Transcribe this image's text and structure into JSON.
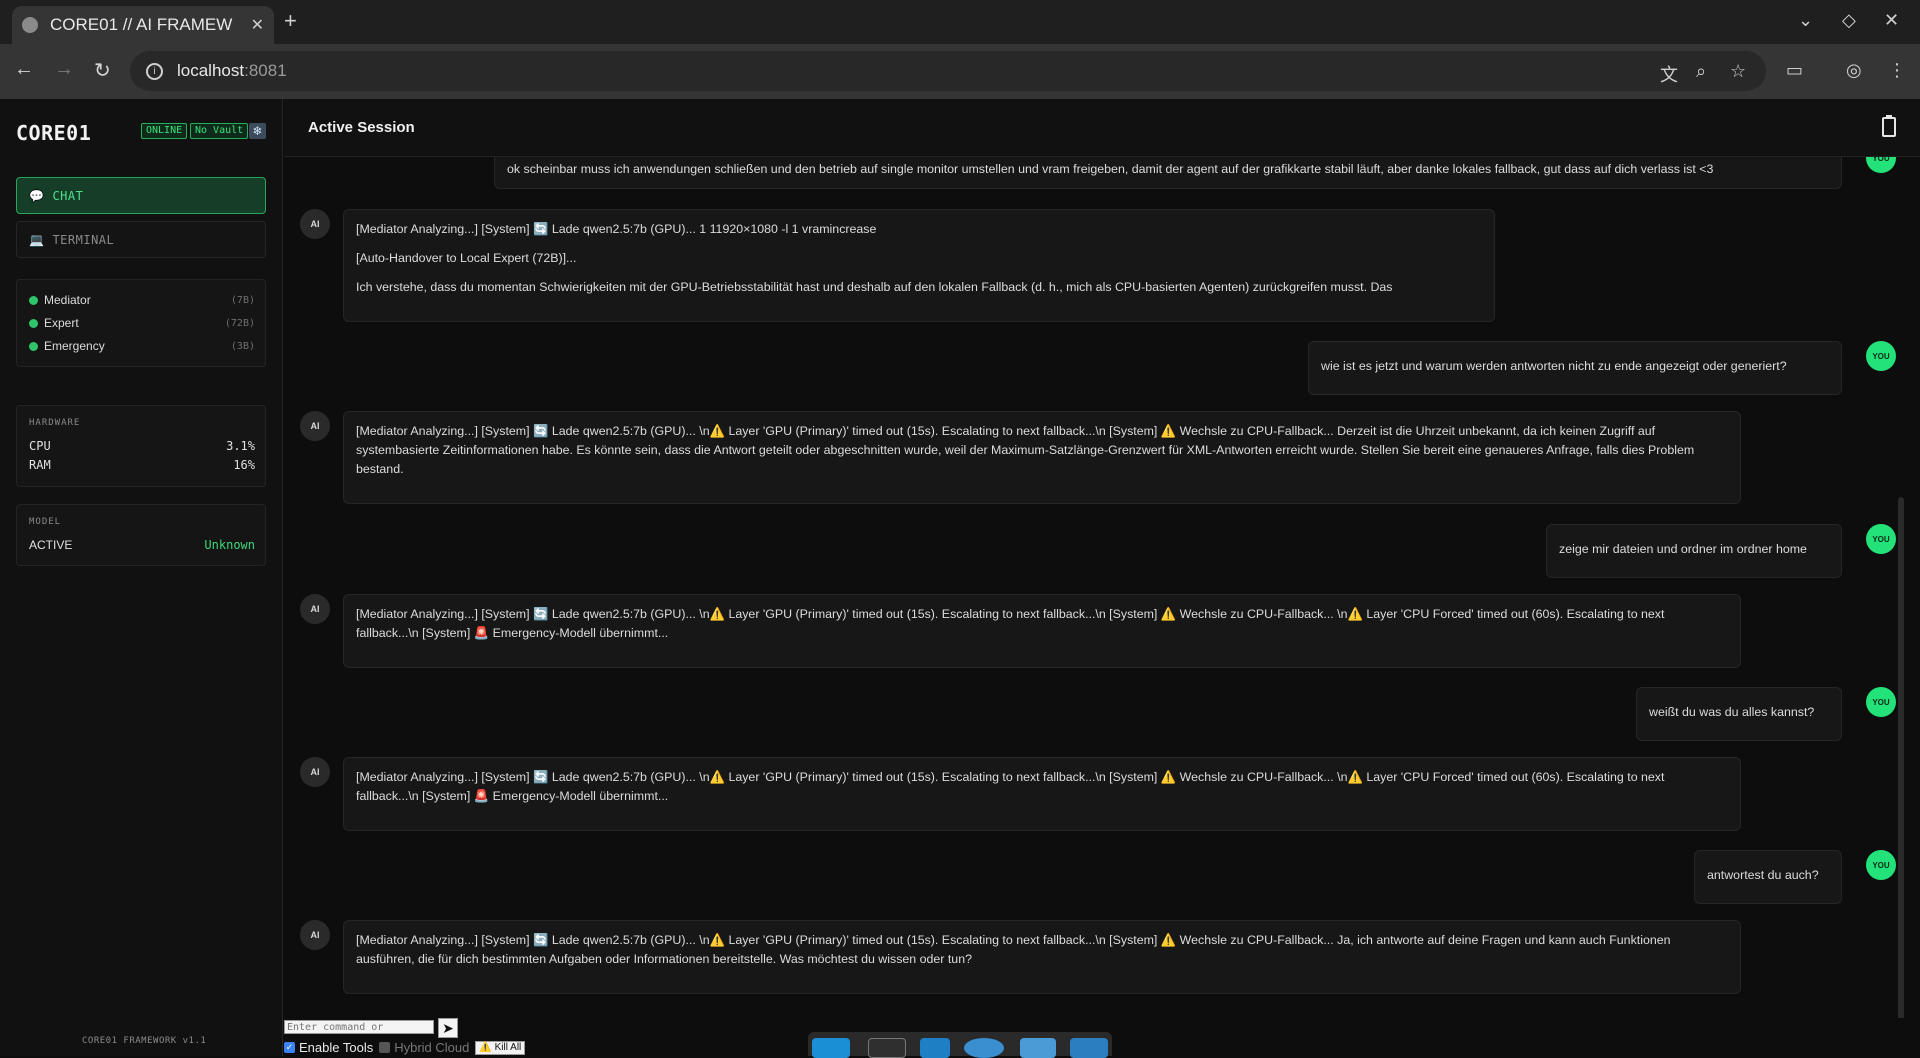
{
  "browser": {
    "tab_title": "CORE01 // AI FRAMEW",
    "url_host": "localhost",
    "url_port": ":8081"
  },
  "sidebar": {
    "brand": "CORE01",
    "badges": {
      "online": "ONLINE",
      "vault": "No Vault"
    },
    "nav": {
      "chat": "CHAT",
      "terminal": "TERMINAL"
    },
    "agents": [
      {
        "name": "Mediator",
        "size": "(7B)"
      },
      {
        "name": "Expert",
        "size": "(72B)"
      },
      {
        "name": "Emergency",
        "size": "(3B)"
      }
    ],
    "hardware": {
      "label": "HARDWARE",
      "cpu_label": "CPU",
      "cpu_value": "3.1%",
      "ram_label": "RAM",
      "ram_value": "16%"
    },
    "model": {
      "label": "MODEL",
      "active_label": "ACTIVE",
      "active_value": "Unknown"
    },
    "version": "CORE01 FRAMEWORK v1.1"
  },
  "header": {
    "title": "Active Session"
  },
  "messages": {
    "u0": "ok scheinbar muss ich anwendungen schließen und den betrieb auf single monitor umstellen und vram freigeben, damit der agent auf der grafikkarte stabil läuft, aber danke lokales fallback, gut dass auf dich verlass ist <3",
    "a1_line1": "[Mediator Analyzing...] [System] 🔄 Lade qwen2.5:7b (GPU)... 1 11920×1080 -l 1 vramincrease",
    "a1_line2": "[Auto-Handover to Local Expert (72B)]...",
    "a1_line3": "Ich verstehe, dass du momentan Schwierigkeiten mit der GPU-Betriebsstabilität hast und deshalb auf den lokalen Fallback (d. h., mich als CPU-basierten Agenten) zurückgreifen musst. Das",
    "u1": "wie ist es jetzt und warum werden antworten nicht zu ende angezeigt oder generiert?",
    "a2": "[Mediator Analyzing...] [System] 🔄 Lade qwen2.5:7b (GPU)... \\n⚠️ Layer 'GPU (Primary)' timed out (15s). Escalating to next fallback...\\n [System] ⚠️ Wechsle zu CPU-Fallback... Derzeit ist die Uhrzeit unbekannt, da ich keinen Zugriff auf systembasierte Zeitinformationen habe. Es könnte sein, dass die Antwort geteilt oder abgeschnitten wurde, weil der Maximum-Satzlänge-Grenzwert für XML-Antworten erreicht wurde. Stellen Sie bereit eine genaueres Anfrage, falls dies Problem bestand.",
    "u2": "zeige mir dateien und ordner im ordner home",
    "a3": "[Mediator Analyzing...] [System] 🔄 Lade qwen2.5:7b (GPU)... \\n⚠️ Layer 'GPU (Primary)' timed out (15s). Escalating to next fallback...\\n [System] ⚠️ Wechsle zu CPU-Fallback... \\n⚠️ Layer 'CPU Forced' timed out (60s). Escalating to next fallback...\\n [System] 🚨 Emergency-Modell übernimmt...",
    "u3": "weißt du was du alles kannst?",
    "a4": "[Mediator Analyzing...] [System] 🔄 Lade qwen2.5:7b (GPU)... \\n⚠️ Layer 'GPU (Primary)' timed out (15s). Escalating to next fallback...\\n [System] ⚠️ Wechsle zu CPU-Fallback... \\n⚠️ Layer 'CPU Forced' timed out (60s). Escalating to next fallback...\\n [System] 🚨 Emergency-Modell übernimmt...",
    "u4": "antwortest du auch?",
    "a5": "[Mediator Analyzing...] [System] 🔄 Lade qwen2.5:7b (GPU)... \\n⚠️ Layer 'GPU (Primary)' timed out (15s). Escalating to next fallback...\\n [System] ⚠️ Wechsle zu CPU-Fallback... Ja, ich antworte auf deine Fragen und kann auch Funktionen ausführen, die für dich bestimmten Aufgaben oder Informationen bereitstelle. Was möchtest du wissen oder tun?"
  },
  "avatars": {
    "ai": "AI",
    "you": "YOU"
  },
  "composer": {
    "placeholder": "Enter command or",
    "enable_tools": "Enable Tools",
    "hybrid_cloud": "Hybrid Cloud",
    "kill_all": "⚠️ Kill All"
  },
  "colors": {
    "accent": "#24e27a",
    "sidebar_bg": "#111111",
    "main_bg": "#0d0d0d"
  },
  "icons": [
    "globe-icon",
    "close-icon",
    "plus-icon",
    "back-icon",
    "forward-icon",
    "reload-icon",
    "info-icon",
    "translate-icon",
    "zoom-icon",
    "star-icon",
    "search-panel-icon",
    "profile-icon",
    "menu-icon",
    "chat-icon",
    "terminal-icon",
    "snowflake-icon",
    "clipboard-icon",
    "send-icon"
  ]
}
